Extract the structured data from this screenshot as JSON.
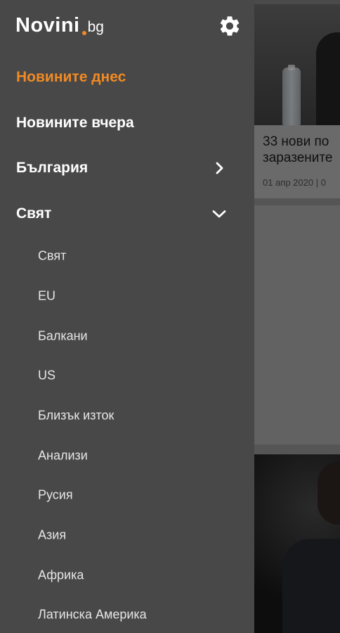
{
  "app": {
    "logo_main": "Novini",
    "logo_tld": "bg"
  },
  "drawer": {
    "settings_icon": "gear-icon",
    "menu": [
      {
        "label": "Новините днес",
        "active": true
      },
      {
        "label": "Новините вчера"
      },
      {
        "label": "България",
        "icon": "chevron-right-icon"
      },
      {
        "label": "Свят",
        "icon": "chevron-down-icon",
        "expanded": true
      }
    ],
    "submenu": [
      {
        "label": "Свят"
      },
      {
        "label": "EU"
      },
      {
        "label": "Балкани"
      },
      {
        "label": "US"
      },
      {
        "label": "Близък изток"
      },
      {
        "label": "Анализи"
      },
      {
        "label": "Русия"
      },
      {
        "label": "Азия"
      },
      {
        "label": "Африка"
      },
      {
        "label": "Латинска Америка"
      }
    ]
  },
  "background": {
    "article": {
      "title": "33 нови по\nзаразените",
      "meta": "01 апр 2020 | 0"
    }
  },
  "colors": {
    "accent": "#f08a24",
    "drawer_bg": "#484848",
    "text": "#ffffff"
  }
}
